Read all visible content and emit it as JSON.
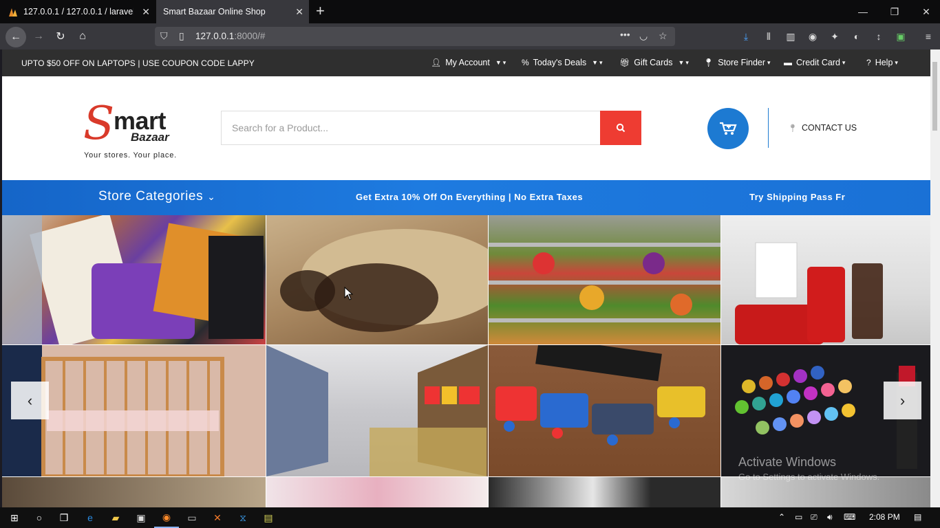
{
  "browser": {
    "tabs": [
      {
        "title": "127.0.0.1 / 127.0.0.1 / laravelkur"
      },
      {
        "title": "Smart Bazaar Online Shop"
      }
    ],
    "url_host": "127.0.0.1",
    "url_rest": ":8000/#"
  },
  "site": {
    "promo": "UPTO $50 OFF ON LAPTOPS | USE COUPON CODE LAPPY",
    "menu": [
      "My Account",
      "Today's Deals",
      "Gift Cards",
      "Store Finder",
      "Credit Card",
      "Help"
    ],
    "logo_s": "S",
    "logo_mart": "mart",
    "logo_bazaar": "Bazaar",
    "tagline": "Your stores. Your place.",
    "search_placeholder": "Search for a Product...",
    "contact": "CONTACT US",
    "categories_label": "Store Categories",
    "banner_mid": "Get Extra 10% Off On Everything | No Extra Taxes",
    "banner_right": "Try Shipping Pass Fr"
  },
  "tiles": [
    "Bags",
    "Hat and sunglasses",
    "Vegetables",
    "Coca-Cola",
    "Crib",
    "Supermarket aisle",
    "Toy train",
    "Makeup palette"
  ],
  "watermark": {
    "line1": "Activate Windows",
    "line2": "Go to Settings to activate Windows."
  },
  "taskbar": {
    "time": "2:08 PM"
  }
}
